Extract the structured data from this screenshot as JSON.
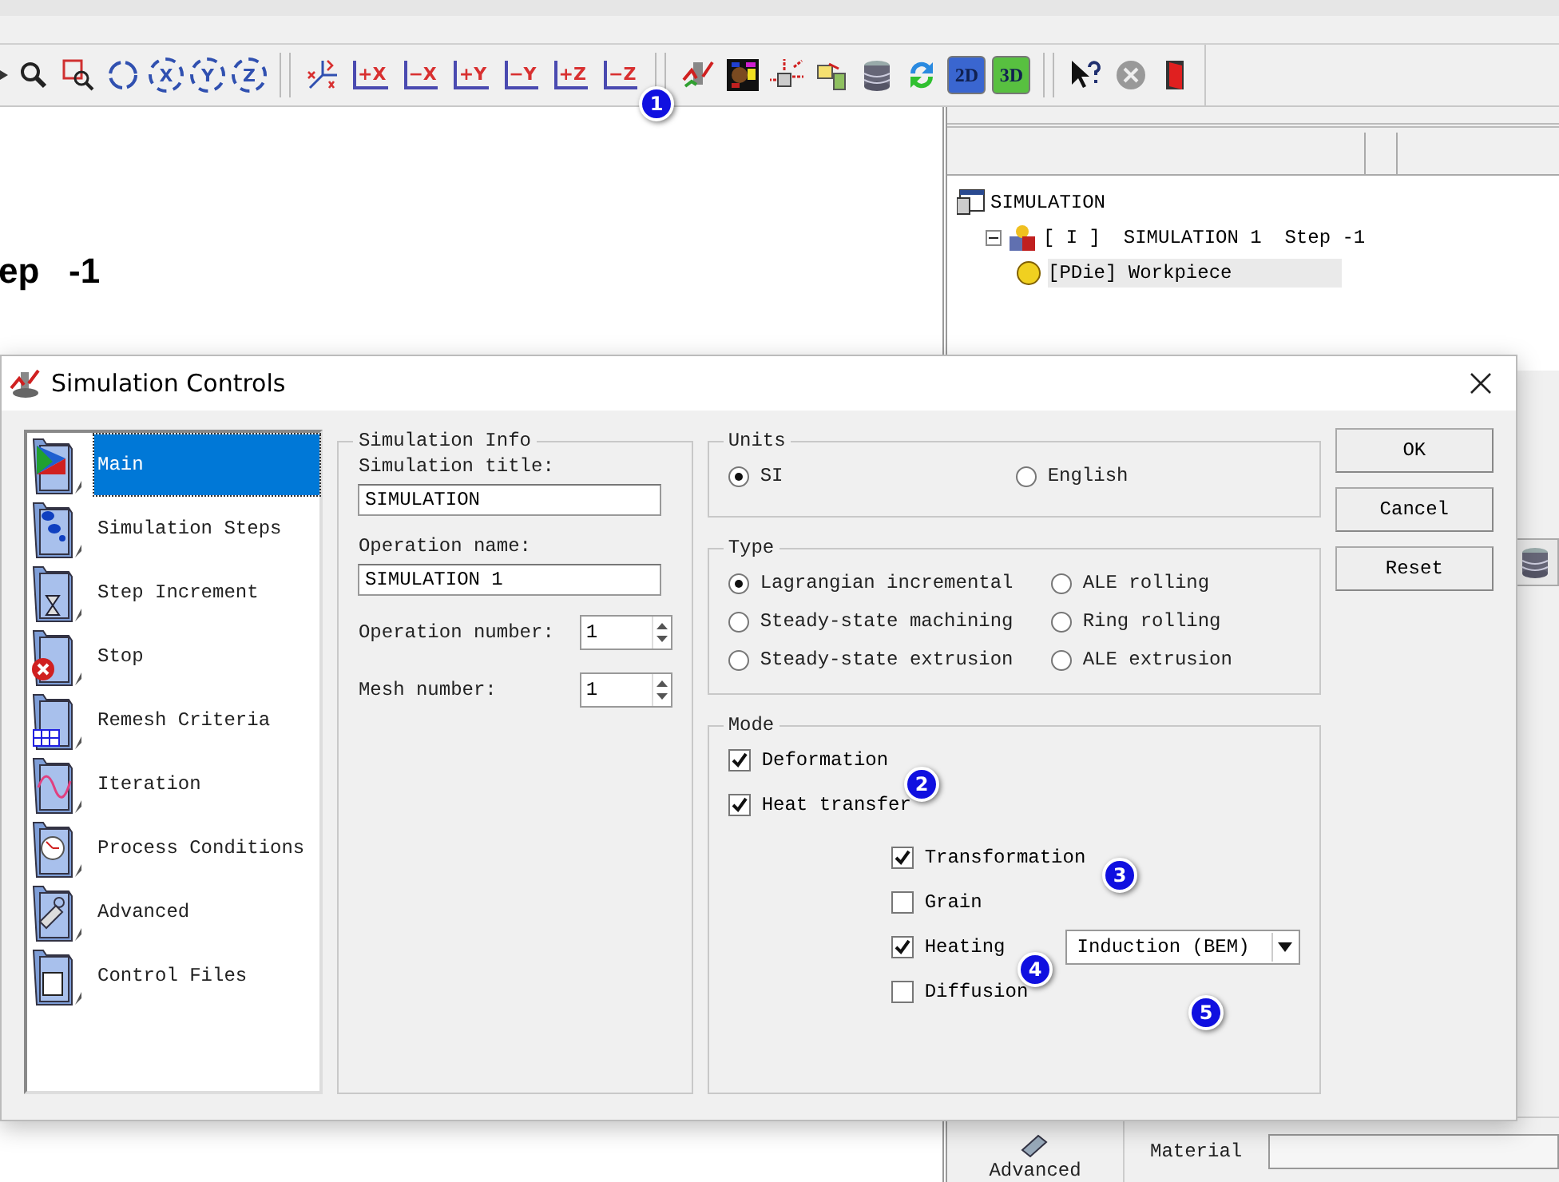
{
  "toolbar": {
    "rotate_buttons": [
      "X",
      "Y",
      "Z"
    ],
    "axis_buttons": [
      "+X",
      "−X",
      "+Y",
      "−Y",
      "+Z",
      "−Z"
    ],
    "view_buttons": [
      "2D",
      "3D"
    ]
  },
  "viewport": {
    "step_text": "ep   -1"
  },
  "tree": {
    "label": "SIMULATION",
    "children": [
      {
        "label": "[ I ]  SIMULATION 1  Step -1",
        "expanded": true,
        "children": [
          {
            "label": "[PDie] Workpiece",
            "selected": true
          }
        ]
      }
    ]
  },
  "side_panel": {
    "advanced_label": "Advanced",
    "material_label": "Material"
  },
  "dialog": {
    "title": "Simulation Controls",
    "nav": [
      {
        "label": "Main",
        "selected": true
      },
      {
        "label": "Simulation Steps",
        "selected": false
      },
      {
        "label": "Step Increment",
        "selected": false
      },
      {
        "label": "Stop",
        "selected": false
      },
      {
        "label": "Remesh Criteria",
        "selected": false
      },
      {
        "label": "Iteration",
        "selected": false
      },
      {
        "label": "Process Conditions",
        "selected": false
      },
      {
        "label": "Advanced",
        "selected": false
      },
      {
        "label": "Control Files",
        "selected": false
      }
    ],
    "simulation_info": {
      "legend": "Simulation Info",
      "title_label": "Simulation title:",
      "title_value": "SIMULATION",
      "operation_label": "Operation name:",
      "operation_value": "SIMULATION 1",
      "operation_number_label": "Operation number:",
      "operation_number": "1",
      "mesh_number_label": "Mesh number:",
      "mesh_number": "1"
    },
    "units": {
      "legend": "Units",
      "options": [
        {
          "label": "SI",
          "selected": true
        },
        {
          "label": "English",
          "selected": false
        }
      ]
    },
    "type": {
      "legend": "Type",
      "options": [
        {
          "label": "Lagrangian incremental",
          "selected": true
        },
        {
          "label": "ALE rolling",
          "selected": false
        },
        {
          "label": "Steady-state machining",
          "selected": false
        },
        {
          "label": "Ring rolling",
          "selected": false
        },
        {
          "label": "Steady-state extrusion",
          "selected": false
        },
        {
          "label": "ALE extrusion",
          "selected": false
        }
      ]
    },
    "mode": {
      "legend": "Mode",
      "options": [
        {
          "label": "Deformation",
          "checked": true
        },
        {
          "label": "Heat transfer",
          "checked": true,
          "children": [
            {
              "label": "Transformation",
              "checked": true
            },
            {
              "label": "Grain",
              "checked": false
            },
            {
              "label": "Heating",
              "checked": true,
              "dropdown": "Induction (BEM)"
            },
            {
              "label": "Diffusion",
              "checked": false
            }
          ]
        }
      ]
    },
    "buttons": [
      "OK",
      "Cancel",
      "Reset"
    ]
  },
  "annotations": [
    "1",
    "2",
    "3",
    "4",
    "5"
  ]
}
